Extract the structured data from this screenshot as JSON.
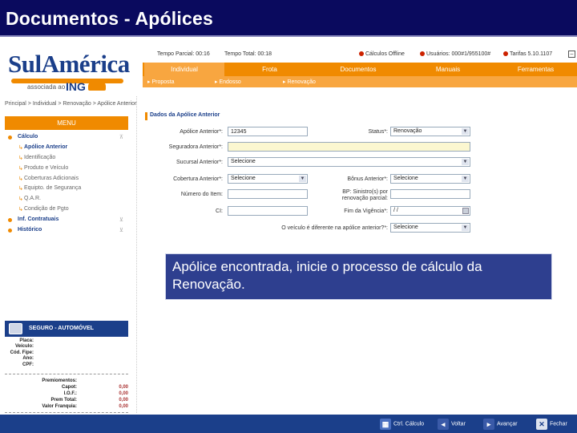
{
  "slide": {
    "title": "Documentos  - Apólices"
  },
  "logo": {
    "brand": "SulAmérica",
    "assoc": "associada ao",
    "ing": "ING"
  },
  "top_info": {
    "tempo_parcial": "Tempo Parcial: 00:16",
    "tempo_total": "Tempo Total: 00:18",
    "calculos": "Cálculos Offline",
    "usuario": "Usuários: 000#1/955100#",
    "tarifas": "Tarifas 5.10.1107"
  },
  "menu": {
    "items": [
      "Individual",
      "Frota",
      "Documentos",
      "Manuais",
      "Ferramentas"
    ],
    "active": "Individual",
    "submenu": [
      "Proposta",
      "Endosso",
      "Renovação"
    ]
  },
  "breadcrumb": "Principal > Individual > Renovação > Apólice Anterior",
  "sidebar": {
    "menu_label": "MENU",
    "tree": [
      {
        "label": "Cálculo",
        "kind": "top",
        "exp": "⊼"
      },
      {
        "label": "Apólice Anterior",
        "kind": "sub",
        "selected": true
      },
      {
        "label": "Identificação",
        "kind": "sub"
      },
      {
        "label": "Produto e Veículo",
        "kind": "sub"
      },
      {
        "label": "Coberturas Adicionais",
        "kind": "sub"
      },
      {
        "label": "Equipto. de Segurança",
        "kind": "sub"
      },
      {
        "label": "Q.A.R.",
        "kind": "sub"
      },
      {
        "label": "Condição de Pgto",
        "kind": "sub"
      },
      {
        "label": "Inf. Contratuais",
        "kind": "top",
        "exp": "⊻"
      },
      {
        "label": "Histórico",
        "kind": "top",
        "exp": "⊻"
      }
    ]
  },
  "seguro": {
    "title": "SEGURO - AUTOMÓVEL",
    "fields": [
      "Placa:",
      "Veículo:",
      "Cód. Fipe:",
      "Ano:",
      "CPF:"
    ],
    "financial": [
      {
        "label": "Premiomentos:",
        "value": ""
      },
      {
        "label": "Capot:",
        "value": "0,00"
      },
      {
        "label": "I.O.F.:",
        "value": "0,00"
      },
      {
        "label": "Prem Total:",
        "value": "0,00"
      },
      {
        "label": "Valor Franquia:",
        "value": "0,00"
      }
    ]
  },
  "form": {
    "section": "Dados da Apólice Anterior",
    "apolice_label": "Apólice Anterior*:",
    "apolice_value": "12345",
    "status_label": "Status*:",
    "status_value": "Renovação",
    "seguradora_label": "Seguradora Anterior*:",
    "seguradora_value": "",
    "sucursal_label": "Sucursal Anterior*:",
    "sucursal_value": "Selecione",
    "cobertura_label": "Cobertura Anterior*:",
    "cobertura_value": "Selecione",
    "bonus_label": "Bônus Anterior*:",
    "bonus_value": "Selecione",
    "numero_item_label": "Número do Item:",
    "numero_item_value": "",
    "bp_label": "BP: Sinistro(s) por renovação parcial:",
    "bp_value": "",
    "ci_label": "CI:",
    "ci_value": "",
    "fim_vigencia_label": "Fim da Vigência*:",
    "fim_vigencia_value": "/ /",
    "question_label": "O veículo é diferente na apólice anterior?*:",
    "question_value": "Selecione"
  },
  "tooltip": "Apólice encontrada, inicie o processo de cálculo da Renovação.",
  "bottom": {
    "buttons": [
      "Ctrl. Cálculo",
      "Voltar",
      "Avançar",
      "Fechar"
    ]
  }
}
